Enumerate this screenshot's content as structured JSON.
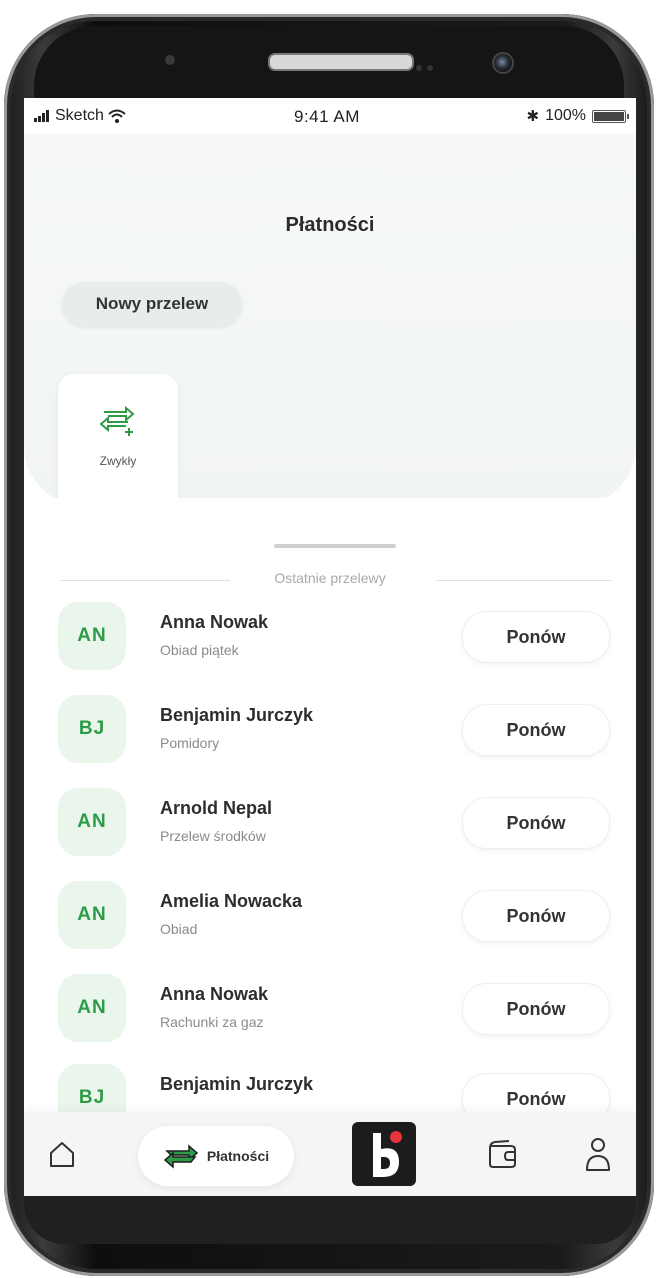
{
  "status_bar": {
    "carrier": "Sketch",
    "time": "9:41 AM",
    "battery": "100%"
  },
  "header": {
    "title": "Płatności"
  },
  "new_transfer": {
    "label": "Nowy przelew"
  },
  "transfer_types": [
    {
      "label": "Zwykły",
      "icon": "transfer-arrows-plus-icon"
    }
  ],
  "recent": {
    "section_title": "Ostatnie przelewy",
    "repeat_label": "Ponów",
    "items": [
      {
        "initials": "AN",
        "name": "Anna Nowak",
        "desc": "Obiad piątek"
      },
      {
        "initials": "BJ",
        "name": "Benjamin Jurczyk",
        "desc": "Pomidory"
      },
      {
        "initials": "AN",
        "name": "Arnold Nepal",
        "desc": "Przelew środków"
      },
      {
        "initials": "AN",
        "name": "Amelia Nowacka",
        "desc": "Obiad"
      },
      {
        "initials": "AN",
        "name": "Anna Nowak",
        "desc": "Rachunki za gaz"
      },
      {
        "initials": "BJ",
        "name": "Benjamin Jurczyk",
        "desc": ""
      }
    ]
  },
  "tab_bar": {
    "items": [
      {
        "icon": "home-icon"
      },
      {
        "icon": "transfer-arrows-icon",
        "label": "Płatności",
        "active": true
      },
      {
        "icon": "brand-logo-icon"
      },
      {
        "icon": "wallet-icon"
      },
      {
        "icon": "user-icon"
      }
    ]
  },
  "colors": {
    "accent_green": "#2e9b47",
    "avatar_bg": "#eaf5ec",
    "brand_dot": "#e8323c"
  }
}
